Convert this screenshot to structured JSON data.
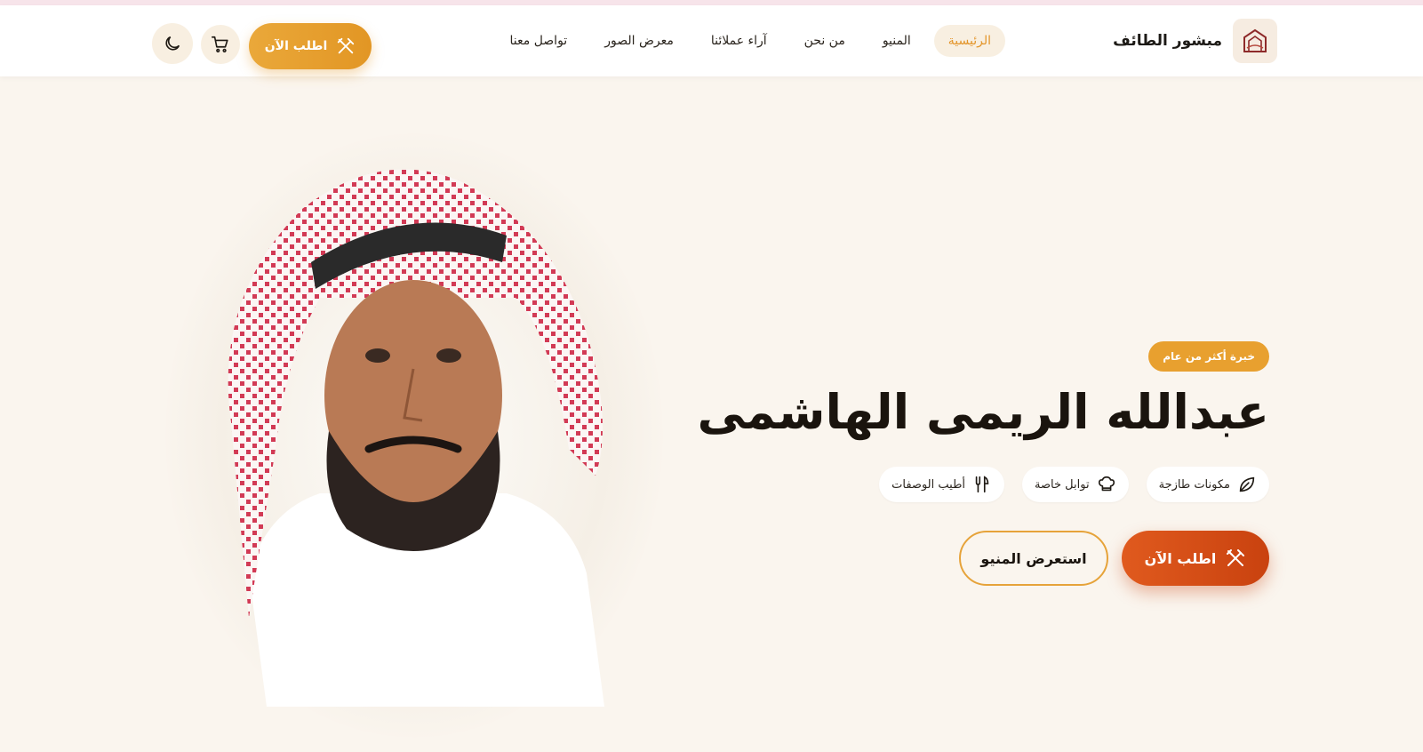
{
  "brand": {
    "name": "مبشور الطائف",
    "logo_text": "الطائف",
    "logo_icon": "restaurant-logo-icon"
  },
  "nav": {
    "items": [
      {
        "label": "الرئيسية",
        "active": true
      },
      {
        "label": "المنيو",
        "active": false
      },
      {
        "label": "من نحن",
        "active": false
      },
      {
        "label": "آراء عملائنا",
        "active": false
      },
      {
        "label": "معرض الصور",
        "active": false
      },
      {
        "label": "تواصل معنا",
        "active": false
      }
    ]
  },
  "header_actions": {
    "order_label": "اطلب الآن",
    "order_icon": "utensils-icon",
    "cart_icon": "cart-icon",
    "theme_icon": "moon-icon"
  },
  "hero": {
    "badge": "خبرة أكثر من عام",
    "title": "عبدالله الريمى الهاشمى",
    "features": [
      {
        "label": "مكونات طازجة",
        "icon": "leaf-icon"
      },
      {
        "label": "توابل خاصة",
        "icon": "chef-hat-icon"
      },
      {
        "label": "أطيب الوصفات",
        "icon": "utensils-icon"
      }
    ],
    "primary_button": "اطلب الآن",
    "secondary_button": "استعرض المنيو"
  },
  "colors": {
    "accent": "#e8a02f",
    "primary": "#d24d16",
    "background": "#faf5ee"
  }
}
